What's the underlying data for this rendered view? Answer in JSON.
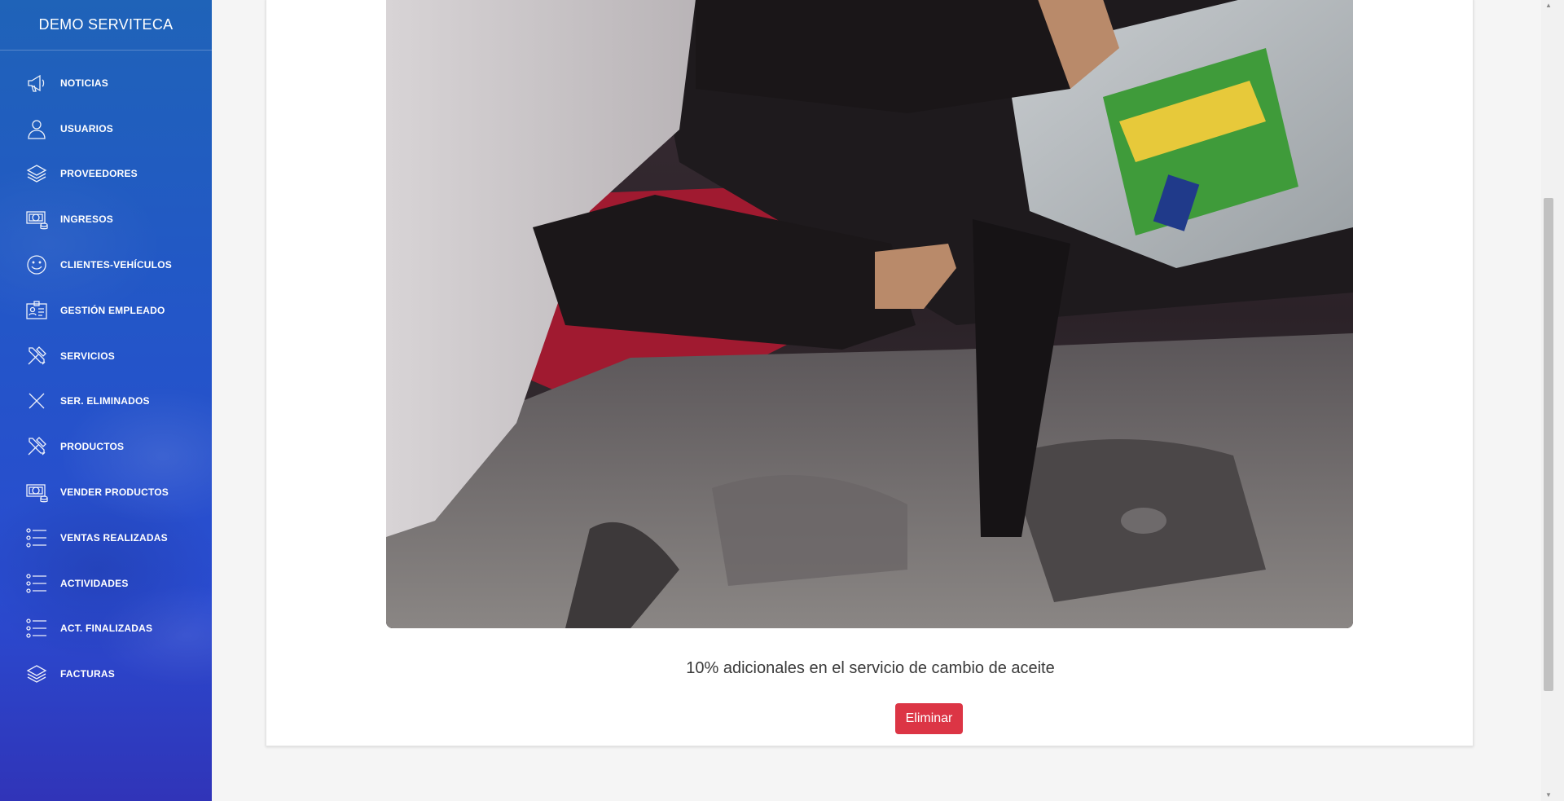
{
  "app": {
    "brand": "DEMO SERVITECA"
  },
  "sidebar": {
    "items": [
      {
        "label": "NOTICIAS",
        "icon": "megaphone-icon"
      },
      {
        "label": "USUARIOS",
        "icon": "user-icon"
      },
      {
        "label": "PROVEEDORES",
        "icon": "layers-icon"
      },
      {
        "label": "INGRESOS",
        "icon": "money-icon"
      },
      {
        "label": "CLIENTES-VEHÍCULOS",
        "icon": "smile-icon"
      },
      {
        "label": "GESTIÓN EMPLEADO",
        "icon": "id-card-icon"
      },
      {
        "label": "SERVICIOS",
        "icon": "tools-icon"
      },
      {
        "label": "SER. ELIMINADOS",
        "icon": "close-icon"
      },
      {
        "label": "PRODUCTOS",
        "icon": "tools-icon"
      },
      {
        "label": "VENDER PRODUCTOS",
        "icon": "money-icon"
      },
      {
        "label": "VENTAS REALIZADAS",
        "icon": "list-icon"
      },
      {
        "label": "ACTIVIDADES",
        "icon": "list-icon"
      },
      {
        "label": "ACT. FINALIZADAS",
        "icon": "list-icon"
      },
      {
        "label": "FACTURAS",
        "icon": "layers-icon"
      }
    ]
  },
  "news": {
    "caption": "10% adicionales en el servicio de cambio de aceite",
    "delete_label": "Eliminar"
  },
  "colors": {
    "sidebar_top": "#1f63b8",
    "sidebar_bottom": "#3034b8",
    "danger": "#dc3545"
  }
}
